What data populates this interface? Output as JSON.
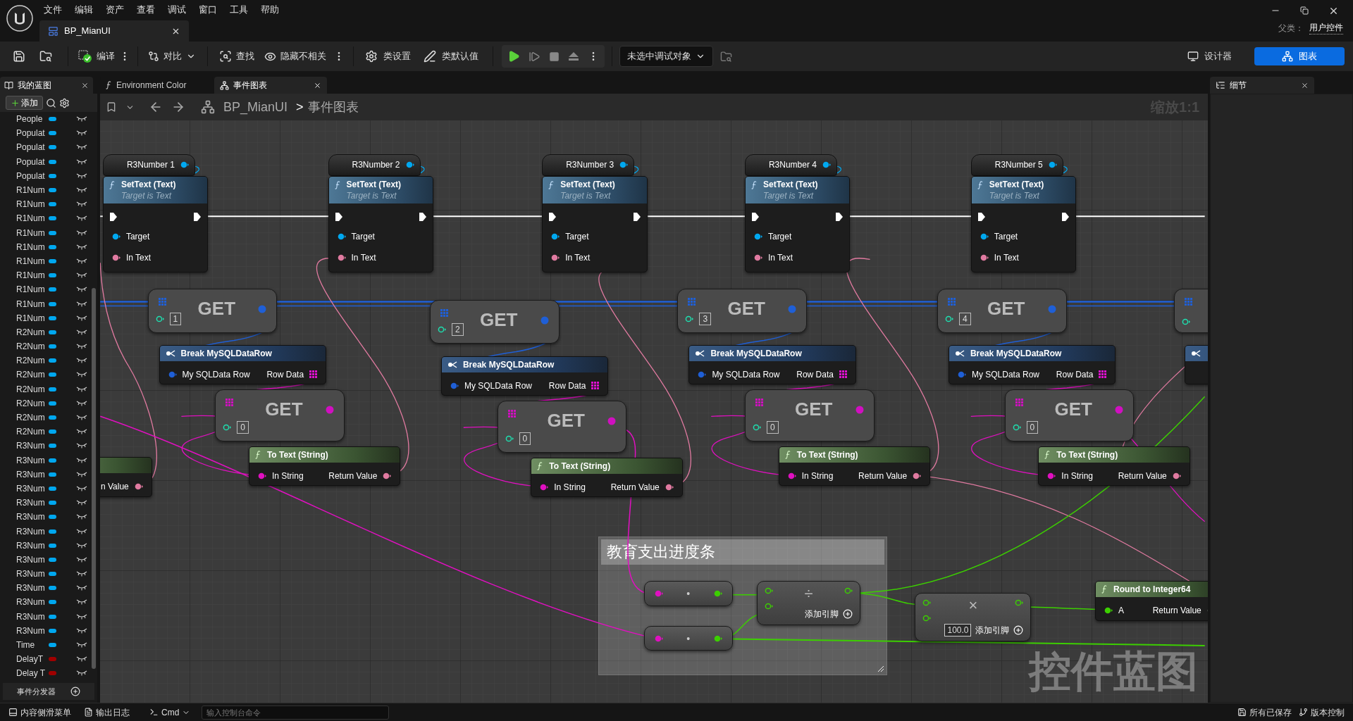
{
  "menu": [
    "文件",
    "编辑",
    "资产",
    "查看",
    "调试",
    "窗口",
    "工具",
    "帮助"
  ],
  "document_tab": {
    "label": "BP_MianUI"
  },
  "parent_class": {
    "label": "父类：",
    "value": "用户控件"
  },
  "toolbar": {
    "compile": "编译",
    "diff": "对比",
    "find": "查找",
    "hide_unrelated": "隐藏不相关",
    "class_settings": "类设置",
    "class_defaults": "类默认值",
    "debug_target": "未选中调试对象"
  },
  "mode_tabs": [
    {
      "label": "设计器",
      "selected": false
    },
    {
      "label": "图表",
      "selected": true
    }
  ],
  "my_blueprint": {
    "tab": "我的蓝图",
    "add_button": "添加",
    "variables": [
      {
        "name": "People",
        "color": "#00a8f0"
      },
      {
        "name": "Populat",
        "color": "#00a8f0"
      },
      {
        "name": "Populat",
        "color": "#00a8f0"
      },
      {
        "name": "Populat",
        "color": "#00a8f0"
      },
      {
        "name": "Populat",
        "color": "#00a8f0"
      },
      {
        "name": "R1Num",
        "color": "#00a8f0"
      },
      {
        "name": "R1Num",
        "color": "#00a8f0"
      },
      {
        "name": "R1Num",
        "color": "#00a8f0"
      },
      {
        "name": "R1Num",
        "color": "#00a8f0"
      },
      {
        "name": "R1Num",
        "color": "#00a8f0"
      },
      {
        "name": "R1Num",
        "color": "#00a8f0"
      },
      {
        "name": "R1Num",
        "color": "#00a8f0"
      },
      {
        "name": "R1Num",
        "color": "#00a8f0"
      },
      {
        "name": "R1Num",
        "color": "#00a8f0"
      },
      {
        "name": "R1Num",
        "color": "#00a8f0"
      },
      {
        "name": "R2Num",
        "color": "#00a8f0"
      },
      {
        "name": "R2Num",
        "color": "#00a8f0"
      },
      {
        "name": "R2Num",
        "color": "#00a8f0"
      },
      {
        "name": "R2Num",
        "color": "#00a8f0"
      },
      {
        "name": "R2Num",
        "color": "#00a8f0"
      },
      {
        "name": "R2Num",
        "color": "#00a8f0"
      },
      {
        "name": "R2Num",
        "color": "#00a8f0"
      },
      {
        "name": "R2Num",
        "color": "#00a8f0"
      },
      {
        "name": "R3Num",
        "color": "#00a8f0"
      },
      {
        "name": "R3Num",
        "color": "#00a8f0"
      },
      {
        "name": "R3Num",
        "color": "#00a8f0"
      },
      {
        "name": "R3Num",
        "color": "#00a8f0"
      },
      {
        "name": "R3Num",
        "color": "#00a8f0"
      },
      {
        "name": "R3Num",
        "color": "#00a8f0"
      },
      {
        "name": "R3Num",
        "color": "#00a8f0"
      },
      {
        "name": "R3Num",
        "color": "#00a8f0"
      },
      {
        "name": "R3Num",
        "color": "#00a8f0"
      },
      {
        "name": "R3Num",
        "color": "#00a8f0"
      },
      {
        "name": "R3Num",
        "color": "#00a8f0"
      },
      {
        "name": "R3Num",
        "color": "#00a8f0"
      },
      {
        "name": "R3Num",
        "color": "#00a8f0"
      },
      {
        "name": "R3Num",
        "color": "#00a8f0"
      },
      {
        "name": "Time",
        "color": "#00a8f0"
      },
      {
        "name": "DelayT",
        "color": "#a00000"
      },
      {
        "name": "Delay T",
        "color": "#a00000"
      }
    ],
    "event_dispatchers": "事件分发器"
  },
  "graph_tabs": [
    {
      "label": "Environment Color",
      "selected": false
    },
    {
      "label": "事件图表",
      "selected": true
    }
  ],
  "breadcrumb": [
    "BP_MianUI",
    ">",
    "事件图表"
  ],
  "zoom_label": "缩放1:1",
  "nodes": [
    {
      "kind": "variable",
      "label": "R3Number 1"
    },
    {
      "kind": "variable",
      "label": "R3Number 2"
    },
    {
      "kind": "variable",
      "label": "R3Number 3"
    },
    {
      "kind": "variable",
      "label": "R3Number 4"
    },
    {
      "kind": "variable",
      "label": "R3Number 5"
    },
    {
      "kind": "settext",
      "title": "SetText (Text)",
      "subtitle": "Target is Text",
      "pins": [
        "Target",
        "In Text"
      ]
    },
    {
      "kind": "settext",
      "title": "SetText (Text)",
      "subtitle": "Target is Text",
      "pins": [
        "Target",
        "In Text"
      ]
    },
    {
      "kind": "settext",
      "title": "SetText (Text)",
      "subtitle": "Target is Text",
      "pins": [
        "Target",
        "In Text"
      ]
    },
    {
      "kind": "settext",
      "title": "SetText (Text)",
      "subtitle": "Target is Text",
      "pins": [
        "Target",
        "In Text"
      ]
    },
    {
      "kind": "settext",
      "title": "SetText (Text)",
      "subtitle": "Target is Text",
      "pins": [
        "Target",
        "In Text"
      ]
    },
    {
      "kind": "get",
      "label": "GET",
      "index": "1",
      "color": "#1f5fd6"
    },
    {
      "kind": "get",
      "label": "GET",
      "index": "2",
      "color": "#1f5fd6"
    },
    {
      "kind": "get",
      "label": "GET",
      "index": "3",
      "color": "#1f5fd6"
    },
    {
      "kind": "get",
      "label": "GET",
      "index": "4",
      "color": "#1f5fd6"
    },
    {
      "kind": "get",
      "color": "#1f5fd6"
    },
    {
      "kind": "break",
      "title": "Break MySQLDataRow",
      "pins": [
        "My SQLData Row",
        "Row Data"
      ]
    },
    {
      "kind": "break",
      "title": "Break MySQLDataRow",
      "pins": [
        "My SQLData Row",
        "Row Data"
      ]
    },
    {
      "kind": "break",
      "title": "Break MySQLDataRow",
      "pins": [
        "My SQLData Row",
        "Row Data"
      ]
    },
    {
      "kind": "break",
      "title": "Break MySQLDataRow",
      "pins": [
        "My SQLData Row",
        "Row Data"
      ]
    },
    {
      "kind": "break"
    },
    {
      "kind": "get",
      "label": "GET",
      "index": "0",
      "color": "#d010c0"
    },
    {
      "kind": "get",
      "label": "GET",
      "index": "0",
      "color": "#d010c0"
    },
    {
      "kind": "get",
      "label": "GET",
      "index": "0",
      "color": "#d010c0"
    },
    {
      "kind": "get",
      "label": "GET",
      "index": "0",
      "color": "#d010c0"
    },
    {
      "kind": "totext",
      "title": "To Text (String)",
      "pins": [
        "In String",
        "Return Value"
      ]
    },
    {
      "kind": "totext",
      "title": "To Text (String)",
      "pins": [
        "In String",
        "Return Value"
      ]
    },
    {
      "kind": "totext",
      "title": "To Text (String)",
      "pins": [
        "In String",
        "Return Value"
      ]
    },
    {
      "kind": "totext",
      "title": "To Text (String)",
      "pins": [
        "In String",
        "Return Value"
      ]
    },
    {
      "kind": "totext",
      "pins": [
        "n Value"
      ]
    },
    {
      "kind": "comment",
      "title": "教育支出进度条"
    },
    {
      "kind": "convert",
      "label": "•"
    },
    {
      "kind": "convert",
      "label": "•"
    },
    {
      "kind": "math",
      "symbol": "÷",
      "add_pin": "添加引脚"
    },
    {
      "kind": "math",
      "symbol": "×",
      "default": "100.0",
      "add_pin": "添加引脚"
    },
    {
      "kind": "round",
      "title": "Round to Integer64",
      "pins": [
        "A",
        "Return Value"
      ]
    }
  ],
  "graph_type_label": "控件蓝图",
  "details_panel": {
    "title": "细节"
  },
  "bottom_bar": {
    "items": [
      "内容侧滑菜单",
      "输出日志"
    ],
    "cmd": "Cmd",
    "console_placeholder": "输入控制台命令",
    "save_status": "所有已保存",
    "source_control": "版本控制"
  }
}
